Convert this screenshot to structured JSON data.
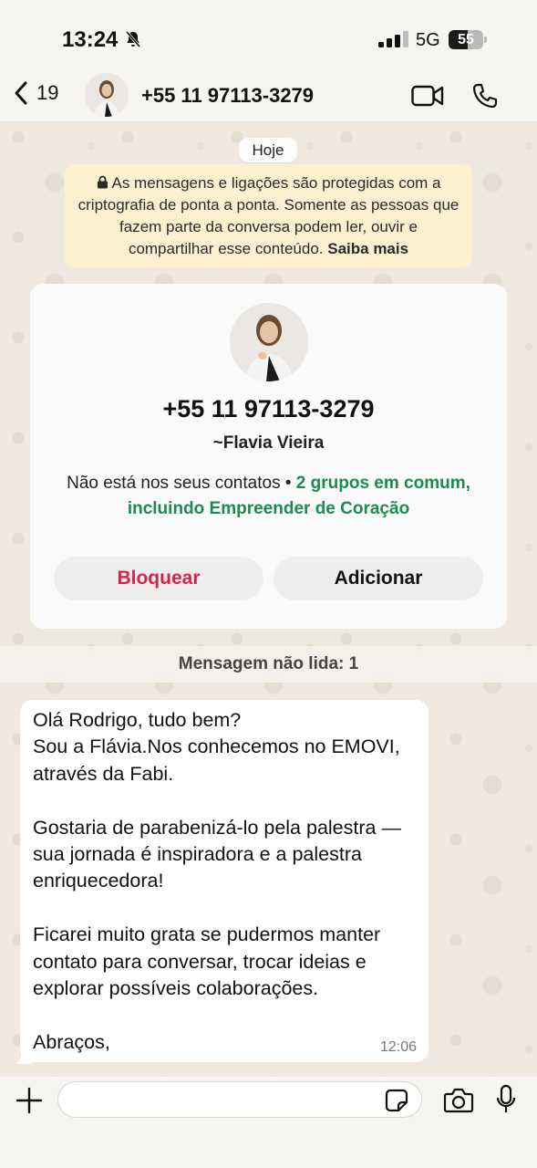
{
  "status_bar": {
    "time": "13:24",
    "network": "5G",
    "battery_level": "55",
    "battery_fraction": 0.55
  },
  "header": {
    "back_count": "19",
    "title": "+55 11 97113-3279"
  },
  "chat": {
    "date_label": "Hoje",
    "encryption_notice": "As mensagens e ligações são protegidas com a criptografia de ponta a ponta. Somente as pessoas que fazem parte da conversa podem ler, ouvir e compartilhar esse conteúdo.",
    "learn_more": "Saiba mais"
  },
  "contact_card": {
    "phone": "+55 11 97113-3279",
    "name": "~Flavia Vieira",
    "not_in_contacts": "Não está nos seus contatos",
    "separator": " • ",
    "groups_in_common": "2 grupos em comum, incluindo Empreender de Coração",
    "block_label": "Bloquear",
    "add_label": "Adicionar"
  },
  "unread_banner": "Mensagem não lida: 1",
  "message": {
    "text": "Olá Rodrigo, tudo bem?\nSou a Flávia.Nos conhecemos no EMOVI, através da Fabi.\n\nGostaria de parabenizá-lo pela palestra — sua jornada é inspiradora e a palestra enriquecedora!\n\nFicarei muito grata se pudermos manter contato para conversar, trocar ideias e explorar possíveis colaborações.\n\nAbraços,",
    "time": "12:06"
  },
  "input_bar": {
    "placeholder": ""
  },
  "colors": {
    "accent_green": "#1c8a54",
    "block_red": "#d8234c",
    "notice_yellow": "#fcf0cf"
  }
}
